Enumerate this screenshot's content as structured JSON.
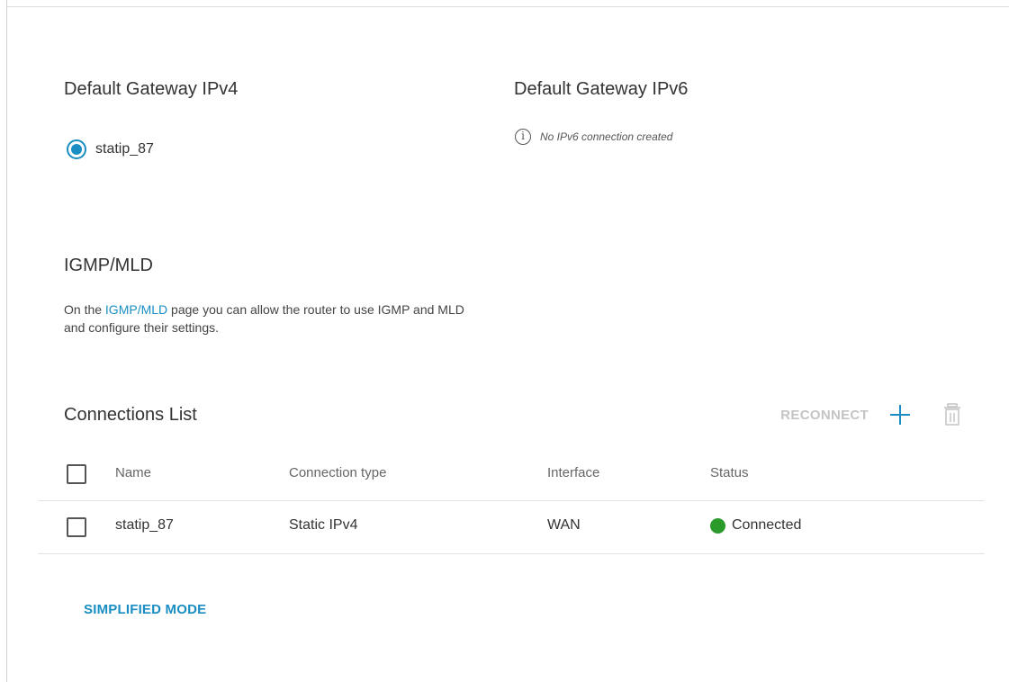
{
  "gateway_ipv4": {
    "title": "Default Gateway IPv4",
    "selected_connection": "statip_87"
  },
  "gateway_ipv6": {
    "title": "Default Gateway IPv6",
    "info_text": "No IPv6 connection created",
    "info_icon": "info-icon"
  },
  "igmp": {
    "title": "IGMP/MLD",
    "text_before": "On the ",
    "link_label": "IGMP/MLD",
    "text_after": " page you can allow the router to use IGMP and MLD and configure their settings."
  },
  "connections": {
    "title": "Connections List",
    "reconnect_label": "RECONNECT",
    "add_icon": "plus-icon",
    "delete_icon": "trash-icon",
    "columns": [
      "Name",
      "Connection type",
      "Interface",
      "Status"
    ],
    "rows": [
      {
        "name": "statip_87",
        "type": "Static IPv4",
        "interface": "WAN",
        "status": "Connected",
        "status_color": "#2a9a2a"
      }
    ]
  },
  "footer": {
    "simplified_mode_label": "SIMPLIFIED MODE"
  },
  "colors": {
    "accent": "#1a8ec2",
    "disabled": "#c4c4c4",
    "connected": "#2a9a2a"
  }
}
